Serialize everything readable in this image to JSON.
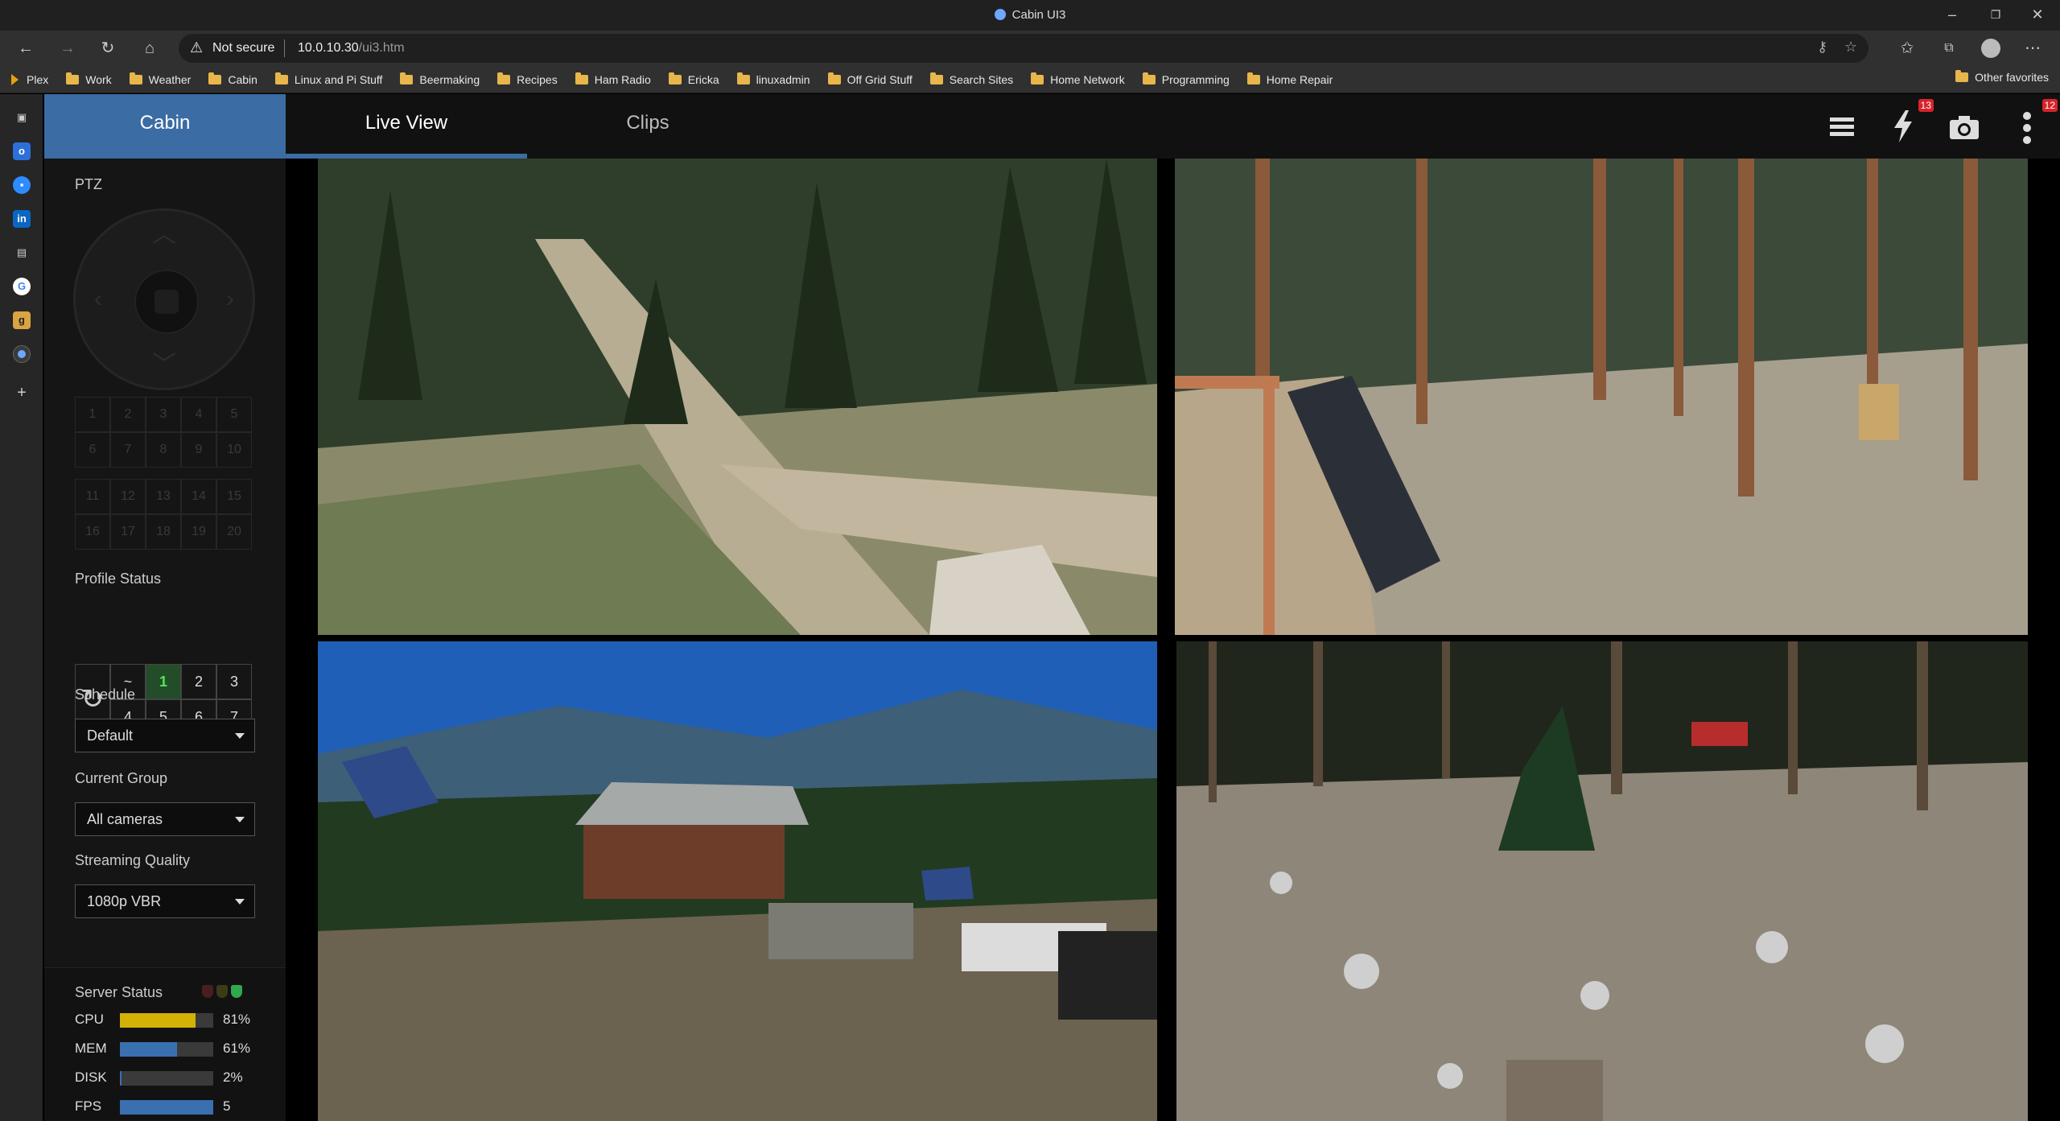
{
  "browser": {
    "window_title": "Cabin UI3",
    "address_warning": "Not secure",
    "url_host": "10.0.10.30",
    "url_path": "/ui3.htm",
    "favorites": [
      "Plex",
      "Work",
      "Weather",
      "Cabin",
      "Linux and Pi Stuff",
      "Beermaking",
      "Recipes",
      "Ham Radio",
      "Ericka",
      "linuxadmin",
      "Off Grid Stuff",
      "Search Sites",
      "Home Network",
      "Programming",
      "Home Repair"
    ],
    "other_favorites": "Other favorites"
  },
  "app": {
    "tabs": {
      "cabin": "Cabin",
      "live": "Live View",
      "clips": "Clips"
    },
    "badges": {
      "alerts": "13",
      "menu": "12"
    },
    "panel": {
      "ptz_label": "PTZ",
      "presets_a": [
        "1",
        "2",
        "3",
        "4",
        "5",
        "6",
        "7",
        "8",
        "9",
        "10"
      ],
      "presets_b": [
        "11",
        "12",
        "13",
        "14",
        "15",
        "16",
        "17",
        "18",
        "19",
        "20"
      ],
      "profile_label": "Profile Status",
      "profile_cells": [
        "~",
        "1",
        "2",
        "3",
        "4",
        "5",
        "6",
        "7"
      ],
      "profile_active": "1",
      "schedule_label": "Schedule",
      "schedule_value": "Default",
      "group_label": "Current Group",
      "group_value": "All cameras",
      "quality_label": "Streaming Quality",
      "quality_value": "1080p VBR"
    },
    "server_status": {
      "title": "Server Status",
      "metrics": [
        {
          "label": "CPU",
          "value": "81%",
          "level": 0.81,
          "color": "#d4b106"
        },
        {
          "label": "MEM",
          "value": "61%",
          "level": 0.61,
          "color": "#3a6fb0"
        },
        {
          "label": "DISK",
          "value": "2%",
          "level": 0.02,
          "color": "#3a6fb0"
        },
        {
          "label": "FPS",
          "value": "5",
          "level": 1.0,
          "color": "#3a6fb0"
        }
      ]
    },
    "icons": [
      "layout-list-icon",
      "lightning-icon",
      "camera-icon",
      "menu-dots-icon"
    ]
  }
}
